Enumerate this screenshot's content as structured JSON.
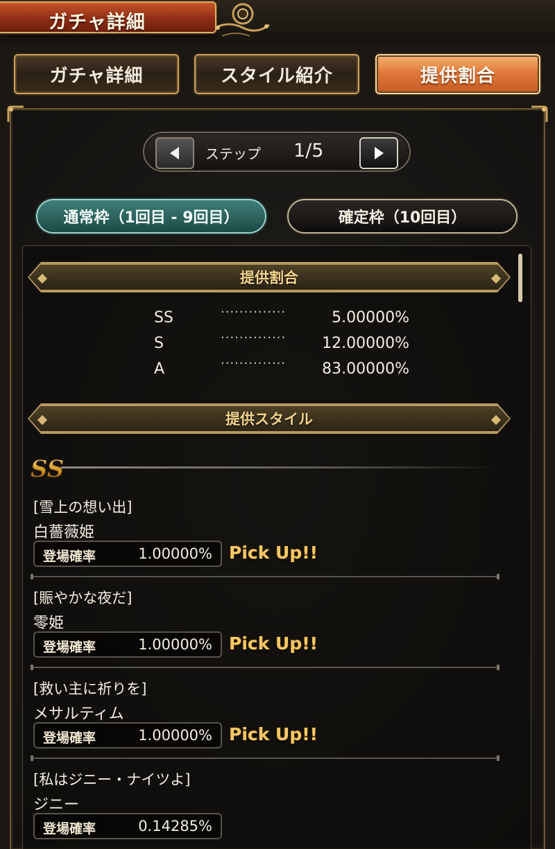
{
  "header": {
    "title": "ガチャ詳細"
  },
  "tabs": [
    {
      "label": "ガチャ詳細",
      "active": false
    },
    {
      "label": "スタイル紹介",
      "active": false
    },
    {
      "label": "提供割合",
      "active": true
    }
  ],
  "stepper": {
    "label": "ステップ",
    "value": "1/5",
    "prev_icon": "triangle-left-icon",
    "next_icon": "triangle-right-icon"
  },
  "frames": [
    {
      "label": "通常枠（1回目 - 9回目）",
      "active": true
    },
    {
      "label": "確定枠（10回目）",
      "active": false
    }
  ],
  "rates_section": {
    "title": "提供割合",
    "rows": [
      {
        "rank": "SS",
        "dots": "··············",
        "value": "5.00000%"
      },
      {
        "rank": "S",
        "dots": "··············",
        "value": "12.00000%"
      },
      {
        "rank": "A",
        "dots": "··············",
        "value": "83.00000%"
      }
    ]
  },
  "styles_section": {
    "title": "提供スタイル",
    "rank_emblem": "SS",
    "rate_label": "登場確率",
    "entries": [
      {
        "style": "[雪上の想い出]",
        "name": "白薔薇姫",
        "rate": "1.00000%",
        "pickup": "Pick Up!!"
      },
      {
        "style": "[賑やかな夜だ]",
        "name": "零姫",
        "rate": "1.00000%",
        "pickup": "Pick Up!!"
      },
      {
        "style": "[救い主に祈りを]",
        "name": "メサルティム",
        "rate": "1.00000%",
        "pickup": "Pick Up!!"
      },
      {
        "style": "[私はジニー・ナイツよ]",
        "name": "ジニー",
        "rate": "0.14285%",
        "pickup": ""
      }
    ]
  },
  "colors": {
    "accent_orange": "#e07a3a",
    "teal_active": "#3f7f78",
    "gold": "#f6c766",
    "panel_border": "#6b5634"
  }
}
